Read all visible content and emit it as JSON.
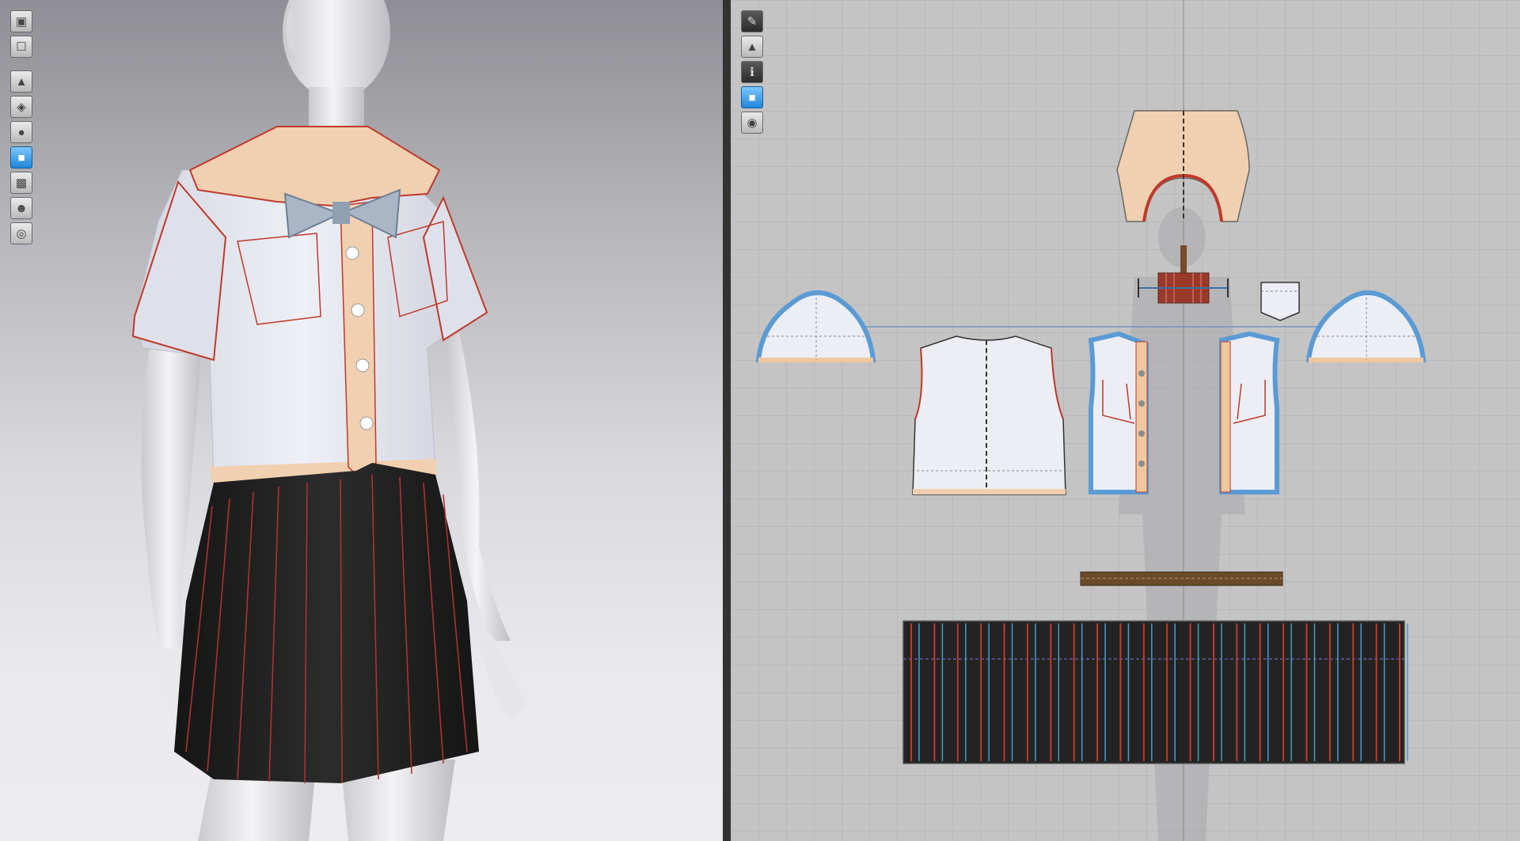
{
  "app": {
    "panels": [
      "3D Garment Window",
      "2D Pattern Window"
    ]
  },
  "toolbar3d": {
    "tools": [
      {
        "name": "display-avatar-icon",
        "active": false
      },
      {
        "name": "display-garment-icon",
        "active": false
      },
      {
        "name": "fitting-mode-icon",
        "active": false
      },
      {
        "name": "texture-view-icon",
        "active": false
      },
      {
        "name": "avatar-view-icon",
        "active": false
      },
      {
        "name": "surface-mode-icon",
        "active": true
      },
      {
        "name": "thickness-view-icon",
        "active": false
      },
      {
        "name": "silhouette-icon",
        "active": false
      },
      {
        "name": "globe-render-icon",
        "active": false
      }
    ]
  },
  "toolbar2d": {
    "tools": [
      {
        "name": "pattern-edit-icon",
        "active": false
      },
      {
        "name": "garment-view-icon",
        "active": false
      },
      {
        "name": "info-icon",
        "active": false
      },
      {
        "name": "fabric-view-icon",
        "active": true
      },
      {
        "name": "lock-garment-icon",
        "active": false
      }
    ]
  },
  "colors": {
    "shirt_fabric": "#e6e8f0",
    "collar_fabric": "#f0d0b0",
    "skirt_fabric": "#222222",
    "seam_line": "#c0392b",
    "selection_outline": "#5b9bd5",
    "canvas_bg": "#c4c4c4"
  }
}
